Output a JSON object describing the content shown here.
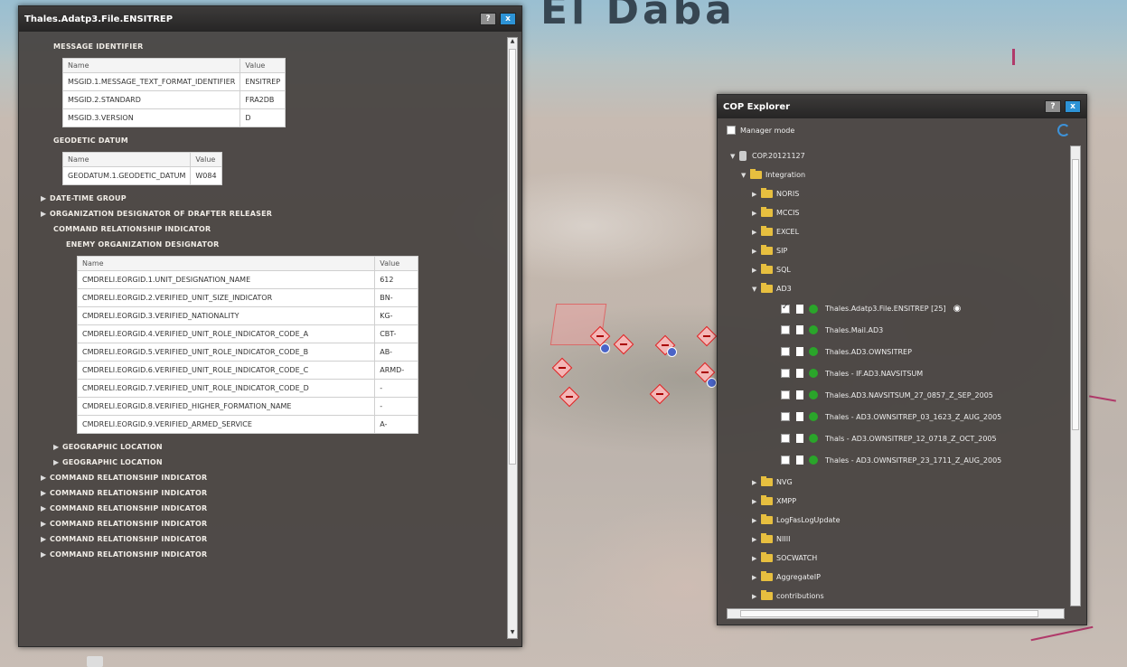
{
  "map": {
    "city_label": "El Daba"
  },
  "detail_window": {
    "title": "Thales.Adatp3.File.ENSITREP",
    "help_label": "?",
    "close_label": "x",
    "sections": {
      "message_identifier": {
        "label": "MESSAGE IDENTIFIER",
        "headers": [
          "Name",
          "Value"
        ],
        "rows": [
          [
            "MSGID.1.MESSAGE_TEXT_FORMAT_IDENTIFIER",
            "ENSITREP"
          ],
          [
            "MSGID.2.STANDARD",
            "FRA2DB"
          ],
          [
            "MSGID.3.VERSION",
            "D"
          ]
        ]
      },
      "geodetic_datum": {
        "label": "GEODETIC DATUM",
        "headers": [
          "Name",
          "Value"
        ],
        "rows": [
          [
            "GEODATUM.1.GEODETIC_DATUM",
            "W084"
          ]
        ]
      },
      "date_time_group": "DATE-TIME GROUP",
      "org_designator": "ORGANIZATION DESIGNATOR OF DRAFTER RELEASER",
      "command_relationship": "COMMAND RELATIONSHIP INDICATOR",
      "enemy_org": {
        "label": "ENEMY ORGANIZATION DESIGNATOR",
        "headers": [
          "Name",
          "Value"
        ],
        "rows": [
          [
            "CMDRELI.EORGID.1.UNIT_DESIGNATION_NAME",
            "612"
          ],
          [
            "CMDRELI.EORGID.2.VERIFIED_UNIT_SIZE_INDICATOR",
            "BN-"
          ],
          [
            "CMDRELI.EORGID.3.VERIFIED_NATIONALITY",
            "KG-"
          ],
          [
            "CMDRELI.EORGID.4.VERIFIED_UNIT_ROLE_INDICATOR_CODE_A",
            "CBT-"
          ],
          [
            "CMDRELI.EORGID.5.VERIFIED_UNIT_ROLE_INDICATOR_CODE_B",
            "AB-"
          ],
          [
            "CMDRELI.EORGID.6.VERIFIED_UNIT_ROLE_INDICATOR_CODE_C",
            "ARMD-"
          ],
          [
            "CMDRELI.EORGID.7.VERIFIED_UNIT_ROLE_INDICATOR_CODE_D",
            "-"
          ],
          [
            "CMDRELI.EORGID.8.VERIFIED_HIGHER_FORMATION_NAME",
            "-"
          ],
          [
            "CMDRELI.EORGID.9.VERIFIED_ARMED_SERVICE",
            "A-"
          ]
        ]
      },
      "geographic_1": "GEOGRAPHIC LOCATION",
      "geographic_2": "GEOGRAPHIC LOCATION",
      "collapsed_items": [
        "COMMAND RELATIONSHIP INDICATOR",
        "COMMAND RELATIONSHIP INDICATOR",
        "COMMAND RELATIONSHIP INDICATOR",
        "COMMAND RELATIONSHIP INDICATOR",
        "COMMAND RELATIONSHIP INDICATOR",
        "COMMAND RELATIONSHIP INDICATOR"
      ]
    }
  },
  "cop_window": {
    "title": "COP Explorer",
    "help_label": "?",
    "close_label": "x",
    "manager_mode": "Manager mode",
    "root": "COP.20121127",
    "integration": "Integration",
    "folders_top": [
      "NORIS",
      "MCCIS",
      "EXCEL",
      "SIP",
      "SQL"
    ],
    "ad3": "AD3",
    "ad3_items": [
      "Thales.Adatp3.File.ENSITREP [25]",
      "Thales.Mail.AD3",
      "Thales.AD3.OWNSITREP",
      "Thales - IF.AD3.NAVSITSUM",
      "Thales.AD3.NAVSITSUM_27_0857_Z_SEP_2005",
      "Thales - AD3.OWNSITREP_03_1623_Z_AUG_2005",
      "Thals - AD3.OWNSITREP_12_0718_Z_OCT_2005",
      "Thales - AD3.OWNSITREP_23_1711_Z_AUG_2005"
    ],
    "folders_bottom": [
      "NVG",
      "XMPP",
      "LogFasLogUpdate",
      "NIIII",
      "SOCWATCH",
      "AggregateIP",
      "contributions"
    ]
  }
}
